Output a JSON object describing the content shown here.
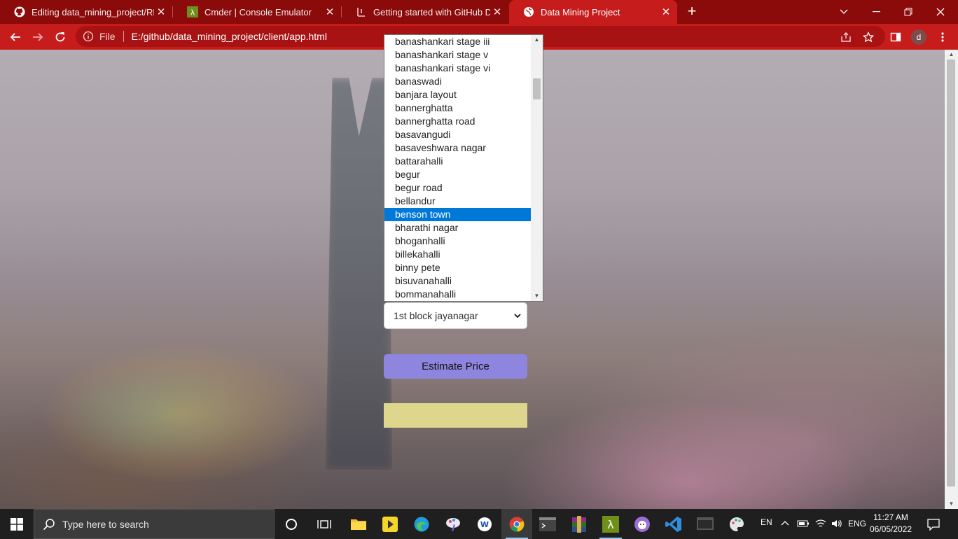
{
  "browser": {
    "tabs": [
      {
        "label": "Editing data_mining_project/README.md",
        "icon": "github-icon",
        "active": false
      },
      {
        "label": "Cmder | Console Emulator",
        "icon": "cmder-icon",
        "active": false
      },
      {
        "label": "Getting started with GitHub Desktop",
        "icon": "github-desktop-icon",
        "active": false
      },
      {
        "label": "Data Mining Project",
        "icon": "globe-icon",
        "active": true
      }
    ],
    "new_tab": "+",
    "address": {
      "scheme_label": "File",
      "url": "E:/github/data_mining_project/client/app.html"
    },
    "profile_initial": "d"
  },
  "page": {
    "location_options": [
      "banashankari stage iii",
      "banashankari stage v",
      "banashankari stage vi",
      "banaswadi",
      "banjara layout",
      "bannerghatta",
      "bannerghatta road",
      "basavangudi",
      "basaveshwara nagar",
      "battarahalli",
      "begur",
      "begur road",
      "bellandur",
      "benson town",
      "bharathi nagar",
      "bhoganhalli",
      "billekahalli",
      "binny pete",
      "bisuvanahalli",
      "bommanahalli"
    ],
    "highlighted_option": "benson town",
    "location_select_value": "1st block jayanagar",
    "estimate_button": "Estimate Price",
    "result_text": ""
  },
  "taskbar": {
    "search_placeholder": "Type here to search",
    "language": "EN",
    "input_lang": "ENG",
    "time": "11:27 AM",
    "date": "06/05/2022"
  },
  "colors": {
    "tab_strip": "#8b0a0a",
    "toolbar": "#c61c1c",
    "estimate_button": "#8e85de",
    "result_box": "#ded68c",
    "selected_option": "#0078d7"
  }
}
